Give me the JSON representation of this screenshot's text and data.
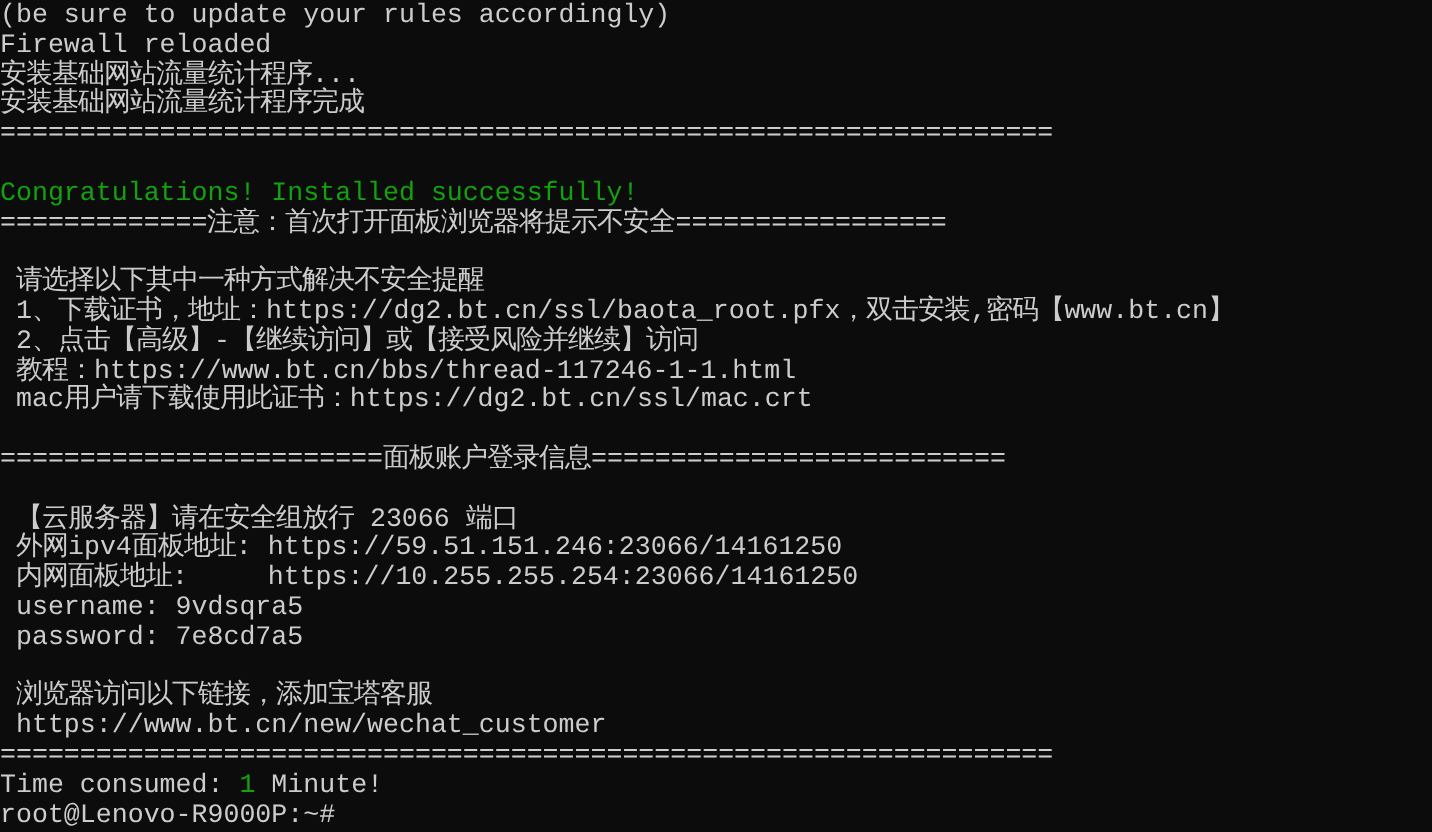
{
  "terminal": {
    "lines": [
      {
        "kind": "text",
        "segments": [
          {
            "text": "(be sure to update your rules accordingly)",
            "highlight": false
          }
        ]
      },
      {
        "kind": "text",
        "segments": [
          {
            "text": "Firewall reloaded",
            "highlight": false
          }
        ]
      },
      {
        "kind": "text",
        "segments": [
          {
            "text": "安装基础网站流量统计程序...",
            "highlight": false
          }
        ]
      },
      {
        "kind": "text",
        "segments": [
          {
            "text": "安装基础网站流量统计程序完成",
            "highlight": false
          }
        ]
      },
      {
        "kind": "text",
        "segments": [
          {
            "text": "==================================================================",
            "highlight": false
          }
        ]
      },
      {
        "kind": "blank"
      },
      {
        "kind": "text",
        "segments": [
          {
            "text": "Congratulations! Installed successfully!",
            "highlight": true
          }
        ]
      },
      {
        "kind": "text",
        "segments": [
          {
            "text": "=============注意：首次打开面板浏览器将提示不安全=================",
            "highlight": false
          }
        ]
      },
      {
        "kind": "blank"
      },
      {
        "kind": "text",
        "segments": [
          {
            "text": " 请选择以下其中一种方式解决不安全提醒",
            "highlight": false
          }
        ]
      },
      {
        "kind": "text",
        "segments": [
          {
            "text": " 1、下载证书，地址：https://dg2.bt.cn/ssl/baota_root.pfx，双击安装,密码【www.bt.cn】",
            "highlight": false
          }
        ]
      },
      {
        "kind": "text",
        "segments": [
          {
            "text": " 2、点击【高级】-【继续访问】或【接受风险并继续】访问",
            "highlight": false
          }
        ]
      },
      {
        "kind": "text",
        "segments": [
          {
            "text": " 教程：https://www.bt.cn/bbs/thread-117246-1-1.html",
            "highlight": false
          }
        ]
      },
      {
        "kind": "text",
        "segments": [
          {
            "text": " mac用户请下载使用此证书：https://dg2.bt.cn/ssl/mac.crt",
            "highlight": false
          }
        ]
      },
      {
        "kind": "blank"
      },
      {
        "kind": "text",
        "segments": [
          {
            "text": "========================面板账户登录信息==========================",
            "highlight": false
          }
        ]
      },
      {
        "kind": "blank"
      },
      {
        "kind": "text",
        "segments": [
          {
            "text": " 【云服务器】请在安全组放行 23066 端口",
            "highlight": false
          }
        ]
      },
      {
        "kind": "text",
        "segments": [
          {
            "text": " 外网ipv4面板地址: https://59.51.151.246:23066/14161250",
            "highlight": false
          }
        ]
      },
      {
        "kind": "text",
        "segments": [
          {
            "text": " 内网面板地址:     https://10.255.255.254:23066/14161250",
            "highlight": false
          }
        ]
      },
      {
        "kind": "text",
        "segments": [
          {
            "text": " username: 9vdsqra5",
            "highlight": false
          }
        ]
      },
      {
        "kind": "text",
        "segments": [
          {
            "text": " password: 7e8cd7a5",
            "highlight": false
          }
        ]
      },
      {
        "kind": "blank"
      },
      {
        "kind": "text",
        "segments": [
          {
            "text": " 浏览器访问以下链接，添加宝塔客服",
            "highlight": false
          }
        ]
      },
      {
        "kind": "text",
        "segments": [
          {
            "text": " https://www.bt.cn/new/wechat_customer",
            "highlight": false
          }
        ]
      },
      {
        "kind": "text",
        "segments": [
          {
            "text": "==================================================================",
            "highlight": false
          }
        ]
      },
      {
        "kind": "text",
        "segments": [
          {
            "text": "Time consumed: ",
            "highlight": false
          },
          {
            "text": "1",
            "highlight": true
          },
          {
            "text": " Minute!",
            "highlight": false
          }
        ]
      },
      {
        "kind": "text",
        "segments": [
          {
            "text": "root@Lenovo-R9000P:~#",
            "highlight": false
          }
        ]
      }
    ]
  }
}
